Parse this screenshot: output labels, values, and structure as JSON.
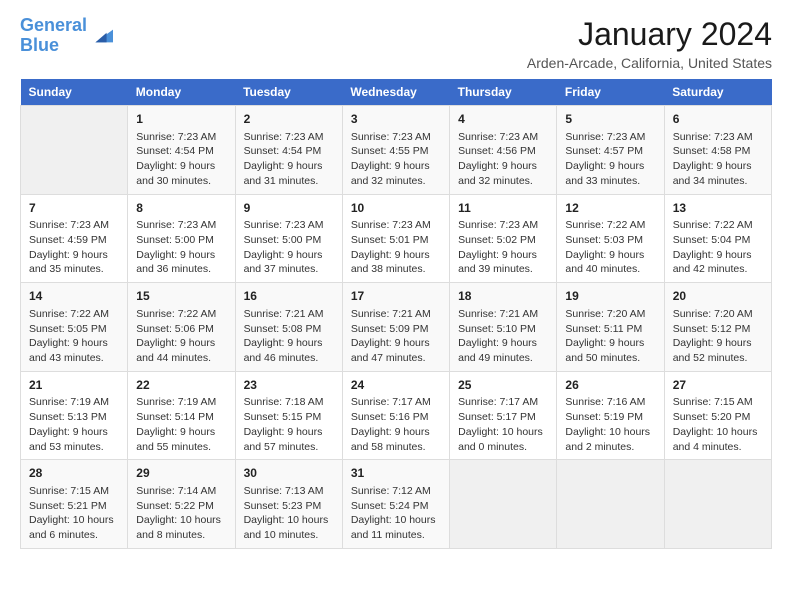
{
  "logo": {
    "line1": "General",
    "line2": "Blue"
  },
  "title": "January 2024",
  "location": "Arden-Arcade, California, United States",
  "headers": [
    "Sunday",
    "Monday",
    "Tuesday",
    "Wednesday",
    "Thursday",
    "Friday",
    "Saturday"
  ],
  "weeks": [
    [
      {
        "day": "",
        "info": ""
      },
      {
        "day": "1",
        "info": "Sunrise: 7:23 AM\nSunset: 4:54 PM\nDaylight: 9 hours\nand 30 minutes."
      },
      {
        "day": "2",
        "info": "Sunrise: 7:23 AM\nSunset: 4:54 PM\nDaylight: 9 hours\nand 31 minutes."
      },
      {
        "day": "3",
        "info": "Sunrise: 7:23 AM\nSunset: 4:55 PM\nDaylight: 9 hours\nand 32 minutes."
      },
      {
        "day": "4",
        "info": "Sunrise: 7:23 AM\nSunset: 4:56 PM\nDaylight: 9 hours\nand 32 minutes."
      },
      {
        "day": "5",
        "info": "Sunrise: 7:23 AM\nSunset: 4:57 PM\nDaylight: 9 hours\nand 33 minutes."
      },
      {
        "day": "6",
        "info": "Sunrise: 7:23 AM\nSunset: 4:58 PM\nDaylight: 9 hours\nand 34 minutes."
      }
    ],
    [
      {
        "day": "7",
        "info": "Sunrise: 7:23 AM\nSunset: 4:59 PM\nDaylight: 9 hours\nand 35 minutes."
      },
      {
        "day": "8",
        "info": "Sunrise: 7:23 AM\nSunset: 5:00 PM\nDaylight: 9 hours\nand 36 minutes."
      },
      {
        "day": "9",
        "info": "Sunrise: 7:23 AM\nSunset: 5:00 PM\nDaylight: 9 hours\nand 37 minutes."
      },
      {
        "day": "10",
        "info": "Sunrise: 7:23 AM\nSunset: 5:01 PM\nDaylight: 9 hours\nand 38 minutes."
      },
      {
        "day": "11",
        "info": "Sunrise: 7:23 AM\nSunset: 5:02 PM\nDaylight: 9 hours\nand 39 minutes."
      },
      {
        "day": "12",
        "info": "Sunrise: 7:22 AM\nSunset: 5:03 PM\nDaylight: 9 hours\nand 40 minutes."
      },
      {
        "day": "13",
        "info": "Sunrise: 7:22 AM\nSunset: 5:04 PM\nDaylight: 9 hours\nand 42 minutes."
      }
    ],
    [
      {
        "day": "14",
        "info": "Sunrise: 7:22 AM\nSunset: 5:05 PM\nDaylight: 9 hours\nand 43 minutes."
      },
      {
        "day": "15",
        "info": "Sunrise: 7:22 AM\nSunset: 5:06 PM\nDaylight: 9 hours\nand 44 minutes."
      },
      {
        "day": "16",
        "info": "Sunrise: 7:21 AM\nSunset: 5:08 PM\nDaylight: 9 hours\nand 46 minutes."
      },
      {
        "day": "17",
        "info": "Sunrise: 7:21 AM\nSunset: 5:09 PM\nDaylight: 9 hours\nand 47 minutes."
      },
      {
        "day": "18",
        "info": "Sunrise: 7:21 AM\nSunset: 5:10 PM\nDaylight: 9 hours\nand 49 minutes."
      },
      {
        "day": "19",
        "info": "Sunrise: 7:20 AM\nSunset: 5:11 PM\nDaylight: 9 hours\nand 50 minutes."
      },
      {
        "day": "20",
        "info": "Sunrise: 7:20 AM\nSunset: 5:12 PM\nDaylight: 9 hours\nand 52 minutes."
      }
    ],
    [
      {
        "day": "21",
        "info": "Sunrise: 7:19 AM\nSunset: 5:13 PM\nDaylight: 9 hours\nand 53 minutes."
      },
      {
        "day": "22",
        "info": "Sunrise: 7:19 AM\nSunset: 5:14 PM\nDaylight: 9 hours\nand 55 minutes."
      },
      {
        "day": "23",
        "info": "Sunrise: 7:18 AM\nSunset: 5:15 PM\nDaylight: 9 hours\nand 57 minutes."
      },
      {
        "day": "24",
        "info": "Sunrise: 7:17 AM\nSunset: 5:16 PM\nDaylight: 9 hours\nand 58 minutes."
      },
      {
        "day": "25",
        "info": "Sunrise: 7:17 AM\nSunset: 5:17 PM\nDaylight: 10 hours\nand 0 minutes."
      },
      {
        "day": "26",
        "info": "Sunrise: 7:16 AM\nSunset: 5:19 PM\nDaylight: 10 hours\nand 2 minutes."
      },
      {
        "day": "27",
        "info": "Sunrise: 7:15 AM\nSunset: 5:20 PM\nDaylight: 10 hours\nand 4 minutes."
      }
    ],
    [
      {
        "day": "28",
        "info": "Sunrise: 7:15 AM\nSunset: 5:21 PM\nDaylight: 10 hours\nand 6 minutes."
      },
      {
        "day": "29",
        "info": "Sunrise: 7:14 AM\nSunset: 5:22 PM\nDaylight: 10 hours\nand 8 minutes."
      },
      {
        "day": "30",
        "info": "Sunrise: 7:13 AM\nSunset: 5:23 PM\nDaylight: 10 hours\nand 10 minutes."
      },
      {
        "day": "31",
        "info": "Sunrise: 7:12 AM\nSunset: 5:24 PM\nDaylight: 10 hours\nand 11 minutes."
      },
      {
        "day": "",
        "info": ""
      },
      {
        "day": "",
        "info": ""
      },
      {
        "day": "",
        "info": ""
      }
    ]
  ]
}
